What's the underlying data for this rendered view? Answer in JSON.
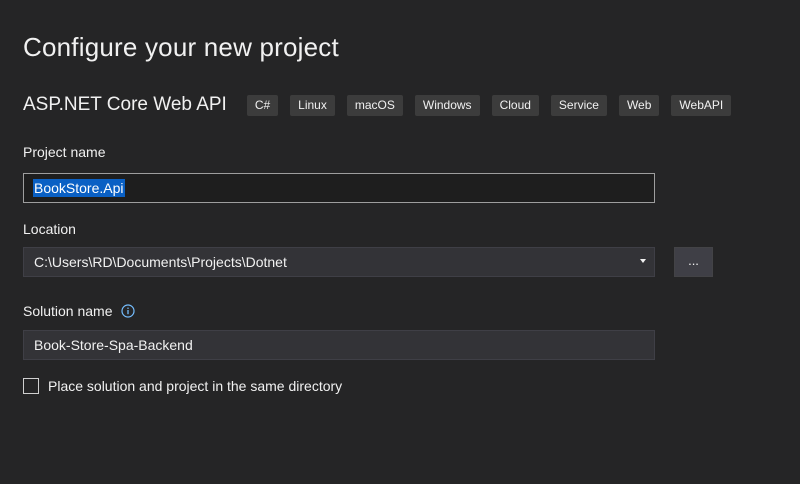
{
  "page": {
    "title": "Configure your new project"
  },
  "template": {
    "name": "ASP.NET Core Web API",
    "tags": [
      "C#",
      "Linux",
      "macOS",
      "Windows",
      "Cloud",
      "Service",
      "Web",
      "WebAPI"
    ]
  },
  "project_name": {
    "label": "Project name",
    "value": "BookStore.Api"
  },
  "location": {
    "label": "Location",
    "value": "C:\\Users\\RD\\Documents\\Projects\\Dotnet",
    "browse_label": "..."
  },
  "solution_name": {
    "label": "Solution name",
    "value": "Book-Store-Spa-Backend",
    "info_icon": "info-icon"
  },
  "same_directory": {
    "label": "Place solution and project in the same directory",
    "checked": false
  },
  "colors": {
    "background": "#252526",
    "input_background": "#333337",
    "focused_input_background": "#1e1e1e",
    "selection": "#0a60c4",
    "tag_background": "#3c3c3c",
    "info_icon": "#75beff"
  }
}
